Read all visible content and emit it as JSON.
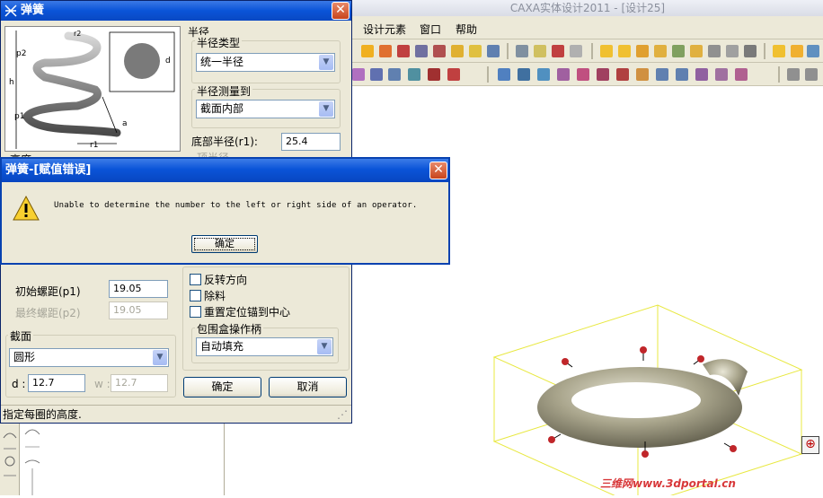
{
  "app": {
    "title": "CAXA实体设计2011 - [设计25]",
    "menu": [
      "设计元素",
      "窗口",
      "帮助"
    ],
    "watermark": "三维网www.3dportal.cn"
  },
  "spring_dialog": {
    "title": "弹簧",
    "preview_labels": {
      "r2": "r2",
      "p2": "p2",
      "h": "h",
      "p1": "p1",
      "r1": "r1",
      "a": "a",
      "d": "d",
      "height_partial": "高度"
    },
    "radius_group": "半径",
    "radius_type_label": "半径类型",
    "radius_type_value": "统一半径",
    "radius_measure_label": "半径测量到",
    "radius_measure_value": "截面内部",
    "bottom_radius_label": "底部半径(r1):",
    "bottom_radius_value": "25.4",
    "top_radius_partial": "顶半径",
    "initial_pitch_label": "初始螺距(p1)",
    "initial_pitch_value": "19.05",
    "final_pitch_label": "最终螺距(p2)",
    "final_pitch_value": "19.05",
    "section_label": "截面",
    "section_value": "圆形",
    "d_label": "d :",
    "d_value": "12.7",
    "w_label": "w :",
    "w_value": "12.7",
    "reverse_label": "反转方向",
    "remove_label": "除料",
    "reset_anchor_label": "重置定位锚到中心",
    "bbox_handle_label": "包围盒操作柄",
    "bbox_handle_value": "自动填充",
    "ok_label": "确定",
    "cancel_label": "取消",
    "status": "指定每圈的高度."
  },
  "error_dialog": {
    "title": "弹簧-[赋值错误]",
    "message": "Unable to determine the number to the left or right side of an operator.",
    "ok_label": "确定"
  }
}
